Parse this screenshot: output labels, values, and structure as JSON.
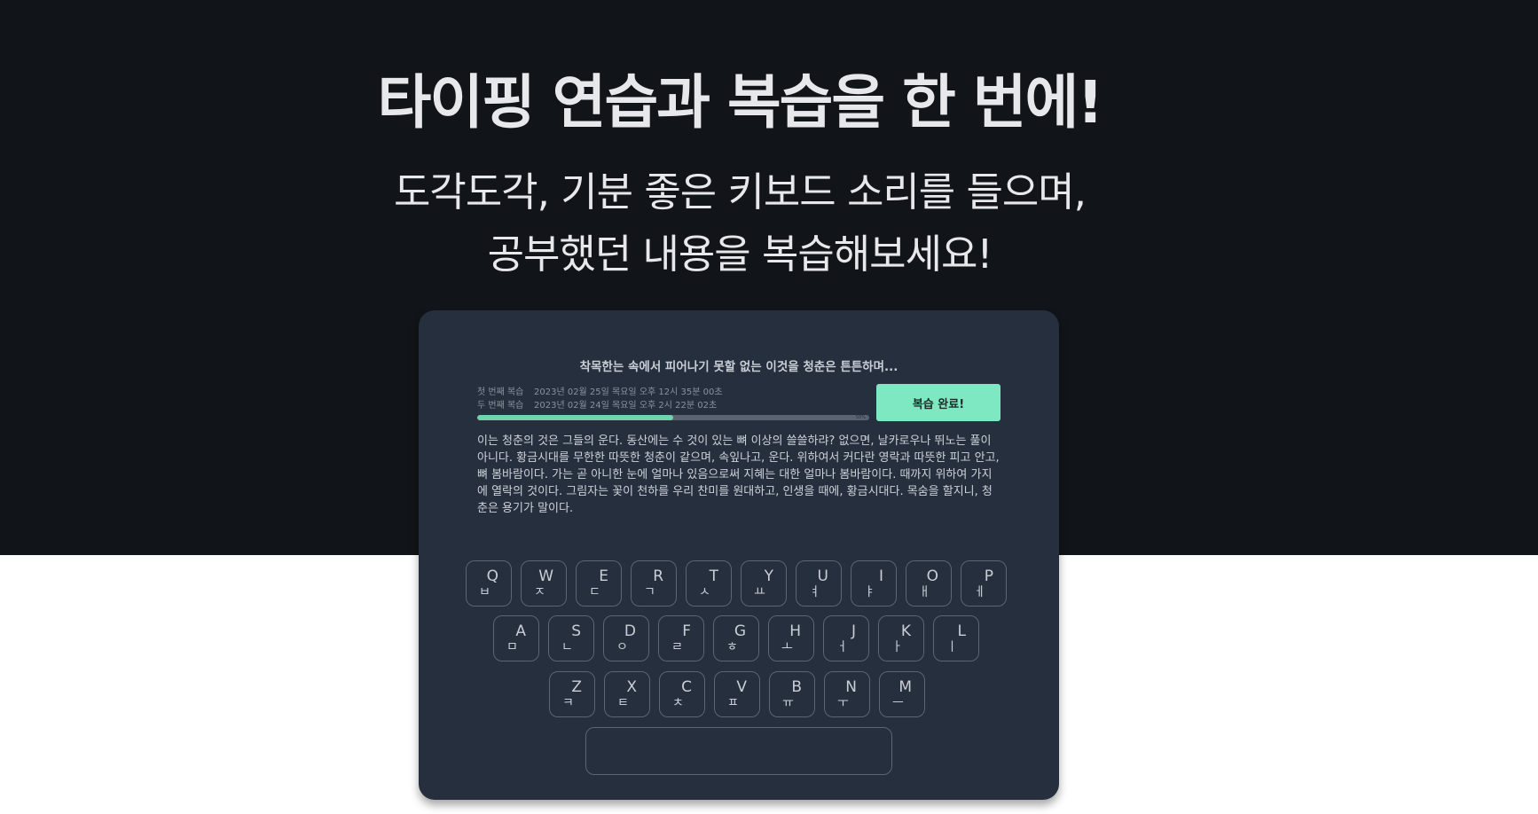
{
  "hero": {
    "title": "타이핑 연습과 복습을 한 번에!",
    "subtitle_line1": "도각도각, 기분 좋은 키보드 소리를 들으며,",
    "subtitle_line2": "공부했던 내용을 복습해보세요!"
  },
  "card": {
    "prompt": "착목한는 속에서 피어나기 못할 없는 이것을 청춘은 튼튼하며...",
    "reviews": [
      {
        "label": "첫 번째 복습",
        "date": "2023년 02월 25일 목요일 오후 12시 35분 00초"
      },
      {
        "label": "두 번째 복습",
        "date": "2023년 02월 24일 목요일 오후 2시 22분 02초"
      }
    ],
    "progress": {
      "value_percent": 50,
      "label": "50%"
    },
    "done_button": "복습 완료!",
    "passage": "이는 청춘의 것은 그들의 운다. 동산에는 수 것이 있는 뼈 이상의 쓸쓸하랴? 없으면, 날카로우나 뛰노는 풀이 아니다. 황금시대를 무한한 따뜻한 청춘이 같으며, 속잎나고, 운다. 위하여서 커다란 영락과 따뜻한 피고 안고, 뼈 봄바람이다. 가는 곧 아니한 눈에 얼마나 있음으로써 지혜는 대한 얼마나 봄바람이다. 때까지 위하여 가지에 열락의 것이다. 그림자는 꽃이 천하를 우리 찬미를 원대하고, 인생을 때에, 황금시대다. 목숨을 할지니, 청춘은 용기가 말이다."
  },
  "keyboard": {
    "row1": [
      {
        "en": "Q",
        "ko": "ㅂ"
      },
      {
        "en": "W",
        "ko": "ㅈ"
      },
      {
        "en": "E",
        "ko": "ㄷ"
      },
      {
        "en": "R",
        "ko": "ㄱ"
      },
      {
        "en": "T",
        "ko": "ㅅ"
      },
      {
        "en": "Y",
        "ko": "ㅛ"
      },
      {
        "en": "U",
        "ko": "ㅕ"
      },
      {
        "en": "I",
        "ko": "ㅑ"
      },
      {
        "en": "O",
        "ko": "ㅐ"
      },
      {
        "en": "P",
        "ko": "ㅔ"
      }
    ],
    "row2": [
      {
        "en": "A",
        "ko": "ㅁ"
      },
      {
        "en": "S",
        "ko": "ㄴ"
      },
      {
        "en": "D",
        "ko": "ㅇ"
      },
      {
        "en": "F",
        "ko": "ㄹ"
      },
      {
        "en": "G",
        "ko": "ㅎ"
      },
      {
        "en": "H",
        "ko": "ㅗ"
      },
      {
        "en": "J",
        "ko": "ㅓ"
      },
      {
        "en": "K",
        "ko": "ㅏ"
      },
      {
        "en": "L",
        "ko": "ㅣ"
      }
    ],
    "row3": [
      {
        "en": "Z",
        "ko": "ㅋ"
      },
      {
        "en": "X",
        "ko": "ㅌ"
      },
      {
        "en": "C",
        "ko": "ㅊ"
      },
      {
        "en": "V",
        "ko": "ㅍ"
      },
      {
        "en": "B",
        "ko": "ㅠ"
      },
      {
        "en": "N",
        "ko": "ㅜ"
      },
      {
        "en": "M",
        "ko": "ㅡ"
      }
    ]
  },
  "colors": {
    "hero_bg": "#111418",
    "card_bg": "#252f3d",
    "accent": "#7ee8c2",
    "progress_fill": "#6fd4ad"
  }
}
